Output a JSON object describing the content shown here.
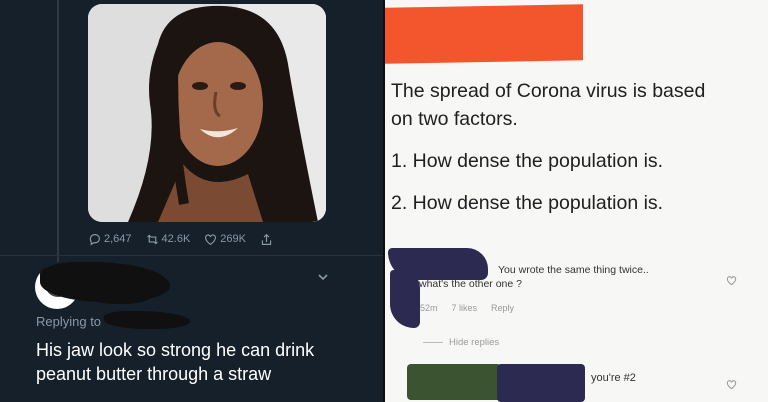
{
  "tweet": {
    "stats": {
      "replies": "2,647",
      "retweets": "42.6K",
      "likes": "269K"
    },
    "reply": {
      "replying_to_prefix": "Replying to",
      "text": "His jaw look so strong he can drink peanut butter through a straw"
    },
    "icons": [
      "reply-icon",
      "retweet-icon",
      "like-icon",
      "share-icon",
      "chevron-down-icon"
    ]
  },
  "post": {
    "lines": [
      "The spread of Corona virus is based",
      "on two factors.",
      "1. How dense the population is.",
      "2. How dense the population is."
    ],
    "comment": {
      "text_line1": "You wrote the same thing twice..",
      "text_line2": "what's the other one ?",
      "time": "52m",
      "likes": "7 likes",
      "reply_label": "Reply",
      "hide_replies": "Hide replies"
    },
    "reply_comment": {
      "text": "you're #2"
    }
  },
  "colors": {
    "twitter_bg": "#15202b",
    "redaction_orange": "#f3552d",
    "redaction_navy": "#2d2a52",
    "redaction_green": "#3b5330"
  }
}
